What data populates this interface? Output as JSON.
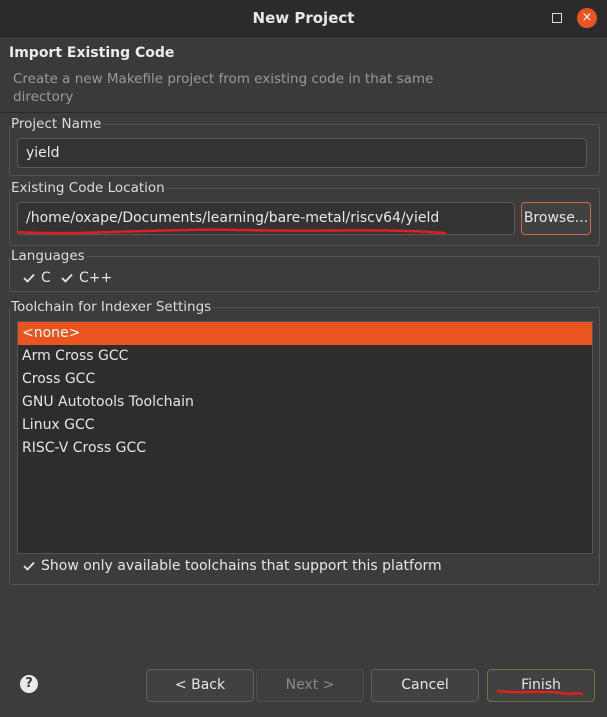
{
  "window": {
    "title": "New Project",
    "maximize_icon": "maximize-icon",
    "close_icon": "close-icon",
    "close_glyph": "×"
  },
  "header": {
    "title": "Import Existing Code",
    "description": "Create a new Makefile project from existing code in that same directory"
  },
  "project_name": {
    "label": "Project Name",
    "value": "yield"
  },
  "code_location": {
    "label": "Existing Code Location",
    "value": "/home/oxape/Documents/learning/bare-metal/riscv64/yield",
    "browse_label": "Browse..."
  },
  "languages": {
    "label": "Languages",
    "items": [
      {
        "label": "C",
        "checked": true
      },
      {
        "label": "C++",
        "checked": true
      }
    ]
  },
  "toolchain": {
    "label": "Toolchain for Indexer Settings",
    "items": [
      "<none>",
      "Arm Cross GCC",
      "Cross GCC",
      "GNU Autotools Toolchain",
      "Linux GCC",
      "RISC-V Cross GCC"
    ],
    "selected": "<none>",
    "filter_label": "Show only available toolchains that support this platform",
    "filter_checked": true
  },
  "footer": {
    "help_glyph": "?",
    "back_label": "< Back",
    "next_label": "Next >",
    "cancel_label": "Cancel",
    "finish_label": "Finish"
  },
  "colors": {
    "accent": "#e95420",
    "annotation": "#e02020"
  }
}
